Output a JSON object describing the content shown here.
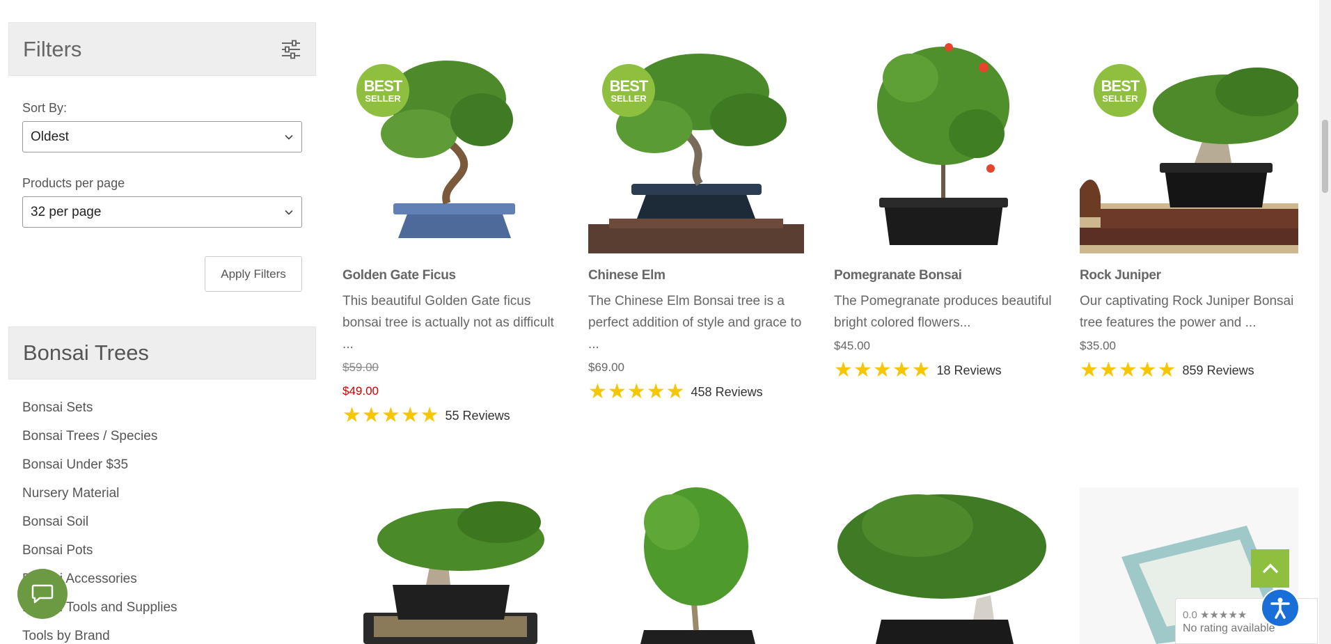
{
  "filters": {
    "title": "Filters",
    "sort_label": "Sort By:",
    "sort_value": "Oldest",
    "perpage_label": "Products per page",
    "perpage_value": "32 per page",
    "apply_label": "Apply Filters"
  },
  "categories": {
    "title": "Bonsai Trees",
    "items": [
      "Bonsai Sets",
      "Bonsai Trees / Species",
      "Bonsai Under $35",
      "Nursery Material",
      "Bonsai Soil",
      "Bonsai Pots",
      "Bonsai Accessories",
      "Bonsai Tools and Supplies",
      "Tools by Brand"
    ]
  },
  "badge": {
    "line1": "BEST",
    "line2": "SELLER"
  },
  "products": [
    {
      "name": "Golden Gate Ficus",
      "desc": "This beautiful Golden Gate ficus bonsai tree is actually not as difficult ...",
      "old_price": "$59.00",
      "price": "$49.00",
      "rating": 5,
      "reviews": "55 Reviews",
      "best_seller": true
    },
    {
      "name": "Chinese Elm",
      "desc": "The Chinese Elm Bonsai tree is a perfect addition of style and grace to ...",
      "price": "$69.00",
      "rating": 5,
      "reviews": "458 Reviews",
      "best_seller": true
    },
    {
      "name": "Pomegranate Bonsai",
      "desc": "The Pomegranate produces beautiful bright colored flowers...",
      "price": "$45.00",
      "rating": 5,
      "reviews": "18 Reviews",
      "best_seller": false
    },
    {
      "name": "Rock Juniper",
      "desc": "Our captivating Rock Juniper Bonsai tree features the power and ...",
      "price": "$35.00",
      "rating": 5,
      "reviews": "859 Reviews",
      "best_seller": true
    }
  ],
  "google_badge": {
    "rating": "0.0 ★★★★★",
    "text": "No rating available"
  },
  "colors": {
    "accent_green": "#8fbf3f",
    "sale_red": "#cc0000",
    "star_yellow": "#f6c602",
    "access_blue": "#1a6ed8"
  }
}
